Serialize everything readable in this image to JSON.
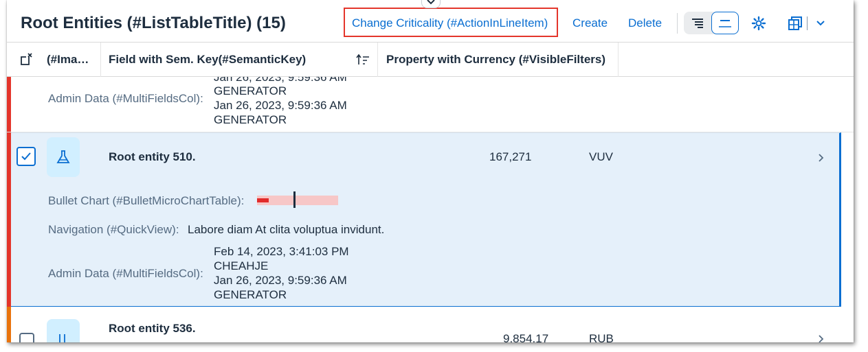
{
  "toolbar": {
    "title": "Root Entities (#ListTableTitle) (15)",
    "action_inline": "Change Criticality (#ActionInLineItem)",
    "create": "Create",
    "delete": "Delete"
  },
  "columns": [
    "(#Ima…",
    "Field with Sem. Key(#SemanticKey)",
    "Property with Currency (#VisibleFilters)"
  ],
  "rows": [
    {
      "admin_label": "Admin Data (#MultiFieldsCol):",
      "admin_values": [
        "Jan 26, 2023, 9:59:36 AM",
        "GENERATOR",
        "Jan 26, 2023, 9:59:36 AM",
        "GENERATOR"
      ],
      "criticality_color": "#e4352b"
    },
    {
      "selected": true,
      "title": "Root entity 510.",
      "amount": "167,271",
      "currency": "VUV",
      "bullet_label": "Bullet Chart (#BulletMicroChartTable):",
      "bullet_value_fraction": 0.14,
      "bullet_target_fraction": 0.45,
      "nav_label": "Navigation (#QuickView):",
      "nav_value": "Labore diam At clita voluptua invidunt.",
      "admin_label": "Admin Data (#MultiFieldsCol):",
      "admin_values": [
        "Feb 14, 2023, 3:41:03 PM",
        "CHEAHJE",
        "Jan 26, 2023, 9:59:36 AM",
        "GENERATOR"
      ],
      "criticality_color": "#e4352b",
      "icon": "lab-flask-icon"
    },
    {
      "title": "Root entity 536.",
      "amount": "9,854.17",
      "currency": "RUB",
      "criticality_color": "#e9730c",
      "icon": "text-align-icon"
    }
  ],
  "colors": {
    "accent": "#0a6ed1",
    "highlight_box": "#e4352b",
    "selected_row_bg": "#e5f0fa"
  }
}
